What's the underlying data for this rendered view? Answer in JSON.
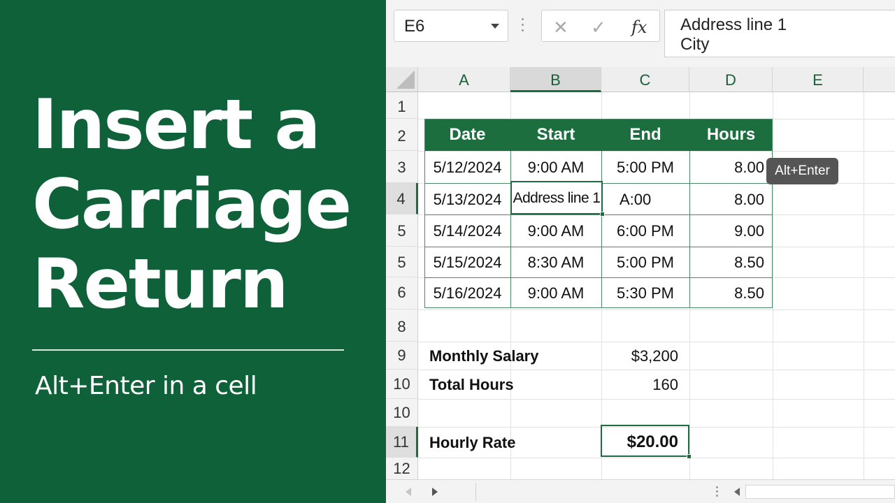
{
  "banner": {
    "title_lines": [
      "Insert a",
      "Carriage",
      "Return"
    ],
    "subtitle": "Alt+Enter in a cell",
    "background_color": "#0e6138"
  },
  "formula_bar": {
    "name_box": "E6",
    "cancel_icon": "x-icon",
    "enter_icon": "check-icon",
    "function_label": "fx",
    "formula_lines": [
      "Address line 1",
      "City"
    ]
  },
  "columns": [
    "A",
    "B",
    "C",
    "D",
    "E"
  ],
  "rows": [
    "1",
    "2",
    "3",
    "4",
    "5",
    "5",
    "6",
    "8",
    "9",
    "10",
    "10",
    "11",
    "12"
  ],
  "table": {
    "headers": [
      "Date",
      "Start",
      "End",
      "Hours"
    ],
    "rows": [
      [
        "5/12/2024",
        "9:00 AM",
        "5:00 PM",
        "8.00"
      ],
      [
        "5/13/2024",
        "Address line 1",
        "A:00",
        "8.00"
      ],
      [
        "5/14/2024",
        "9:00 AM",
        "6:00 PM",
        "9.00"
      ],
      [
        "5/15/2024",
        "8:30 AM",
        "5:00 PM",
        "8.50"
      ],
      [
        "5/16/2024",
        "9:00 AM",
        "5:30 PM",
        "8.50"
      ]
    ],
    "header_color": "#1c6e3f"
  },
  "tooltip": "Alt+Enter",
  "summary": [
    {
      "label": "Monthly Salary",
      "value": "$3,200"
    },
    {
      "label": "Total Hours",
      "value": "160"
    },
    {
      "label": "Hourly Rate",
      "value": "$20.00"
    }
  ]
}
